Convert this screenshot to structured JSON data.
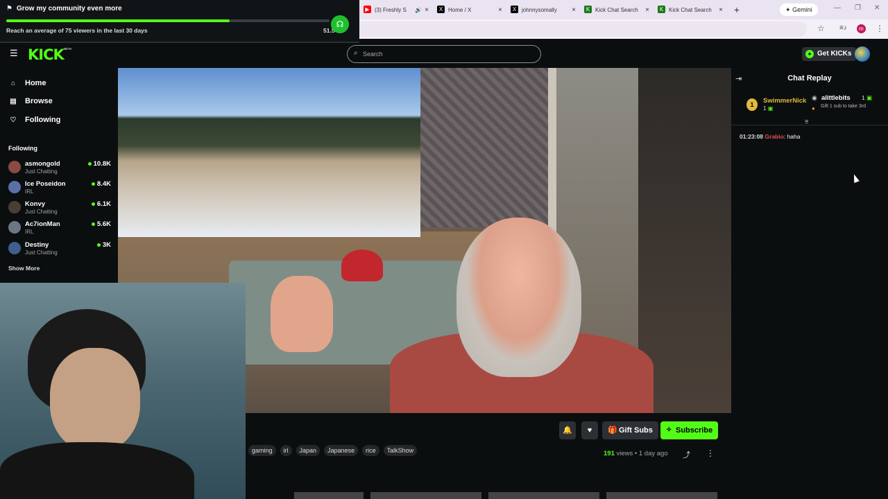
{
  "goal": {
    "title": "Grow my community even more",
    "subtitle": "Reach an average of 75 viewers in the last 30 days",
    "value": "51.5",
    "progress": 0.69,
    "icon": "flag-icon",
    "badge_icon": "headset-icon"
  },
  "browser": {
    "tabs": [
      {
        "title": "(3) Freshly S",
        "icon": "youtube-icon",
        "icon_color": "#ff0000",
        "audio": true
      },
      {
        "title": "Home / X",
        "icon": "x-icon",
        "icon_color": "#000000"
      },
      {
        "title": "johnnysomally",
        "icon": "x-icon",
        "icon_color": "#000000"
      },
      {
        "title": "Kick Chat Search",
        "icon": "kick-icon",
        "icon_color": "#53fc18"
      },
      {
        "title": "Kick Chat Search",
        "icon": "kick-icon",
        "icon_color": "#53fc18"
      }
    ],
    "new_tab": "+",
    "gemini_label": "Gemini",
    "profile_initial": "m"
  },
  "header": {
    "logo": "KICK",
    "logo_sup": "BETA",
    "search_placeholder": "Search",
    "get_kicks": "Get KICKs"
  },
  "sidebar": {
    "nav": [
      {
        "label": "Home",
        "icon": "home-icon"
      },
      {
        "label": "Browse",
        "icon": "browse-icon"
      },
      {
        "label": "Following",
        "icon": "heart-icon"
      }
    ],
    "following_title": "Following",
    "channels": [
      {
        "name": "asmongold",
        "category": "Just Chatting",
        "viewers": "10.8K",
        "avatar_color": "#8a4b44"
      },
      {
        "name": "Ice Poseidon",
        "category": "IRL",
        "viewers": "8.4K",
        "avatar_color": "#5b6fa8"
      },
      {
        "name": "Konvy",
        "category": "Just Chatting",
        "viewers": "6.1K",
        "avatar_color": "#4a3d36"
      },
      {
        "name": "Ac7ionMan",
        "category": "IRL",
        "viewers": "5.6K",
        "avatar_color": "#6d7784"
      },
      {
        "name": "Destiny",
        "category": "Just Chatting",
        "viewers": "3K",
        "avatar_color": "#3f5e8c"
      }
    ],
    "show_more": "Show More"
  },
  "video_actions": {
    "gift_subs": "Gift Subs",
    "subscribe": "Subscribe",
    "tags": [
      "gaming",
      "irl",
      "Japan",
      "Japanese",
      "rice",
      "TalkShow"
    ],
    "views_count": "191",
    "views_label": "views",
    "separator": "•",
    "age": "1 day ago"
  },
  "chat": {
    "title": "Chat Replay",
    "leaderboard": {
      "rank": "1",
      "name": "SwimmerNick",
      "count": "1"
    },
    "pinned": {
      "name": "alittlebits",
      "count": "1",
      "message": "Gift 1 sub to take 3rd"
    },
    "messages": [
      {
        "time": "01:23:08",
        "user": "Grabio",
        "separator": ":",
        "text": "haha"
      }
    ]
  }
}
